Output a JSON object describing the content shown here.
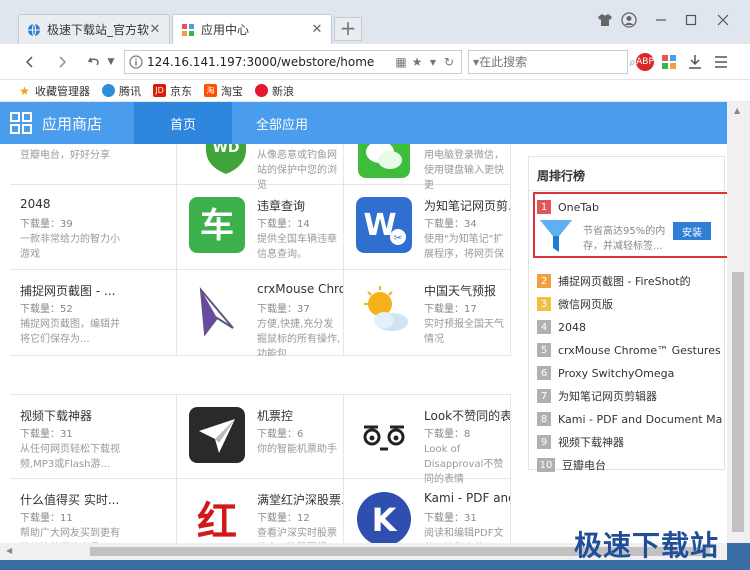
{
  "tabs": [
    {
      "title": "极速下载站_官方软件下载",
      "active": false
    },
    {
      "title": "应用中心",
      "active": true
    }
  ],
  "nav": {
    "url": "124.16.141.197:3000/webstore/home",
    "search_placeholder": "在此搜索"
  },
  "bookmarks": [
    "收藏管理器",
    "腾讯",
    "京东",
    "淘宝",
    "新浪"
  ],
  "store": {
    "brand": "应用商店",
    "nav_home": "首页",
    "nav_all": "全部应用"
  },
  "apps_top": [
    {
      "desc": "豆瓣电台，好好分享"
    },
    {
      "desc": "从像恶意或钓鱼网站的保护中您的浏览"
    },
    {
      "desc": "用电脑登录微信，使用键盘输入更快更"
    }
  ],
  "apps": [
    {
      "name": "2048",
      "downloads": "下载量：39",
      "desc": "一款非常给力的智力小游戏"
    },
    {
      "name": "违章查询",
      "downloads": "下载量：14",
      "desc": "提供全国车辆违章信息查询。"
    },
    {
      "name": "为知笔记网页剪...",
      "downloads": "下载量：34",
      "desc": "使用\"为知笔记\"扩展程序，将网页保"
    },
    {
      "name": "捕捉网页截图 - ...",
      "downloads": "下载量：52",
      "desc": "捕捉网页截图，编辑并将它们保存为..."
    },
    {
      "name": "crxMouse Chro...",
      "downloads": "下载量：37",
      "desc": "方便,快捷,充分发掘鼠标的所有操作,功能包"
    },
    {
      "name": "中国天气预报",
      "downloads": "下载量：17",
      "desc": "实时预报全国天气情况"
    },
    {
      "name": "视频下载神器",
      "downloads": "下载量：31",
      "desc": "从任何网页轻松下载视频,MP3或Flash游..."
    },
    {
      "name": "机票控",
      "downloads": "下载量：6",
      "desc": "你的智能机票助手"
    },
    {
      "name": "Look不赞同的表...",
      "downloads": "下载量：8",
      "desc": "Look of Disapproval不赞同的表情"
    },
    {
      "name": "什么值得买 实时...",
      "downloads": "下载量：11",
      "desc": "帮助广大网友买到更有性价比的网购产品"
    },
    {
      "name": "满堂红沪深股票...",
      "downloads": "下载量：12",
      "desc": "查看沪深实时股票信息以及股票报"
    },
    {
      "name": "Kami - PDF and...",
      "downloads": "下载量：31",
      "desc": "阅读和编辑PDF文件，注释文件"
    }
  ],
  "sidebar": {
    "title": "周排行榜",
    "featured": {
      "rank": "1",
      "name": "OneTab",
      "desc_line1": "节省高达95%的内",
      "desc_line2": "存，并减轻标签...",
      "install": "安装"
    },
    "items": [
      {
        "rank": "2",
        "name": "捕捉网页截图 - FireShot的"
      },
      {
        "rank": "3",
        "name": "微信网页版"
      },
      {
        "rank": "4",
        "name": "2048"
      },
      {
        "rank": "5",
        "name": "crxMouse Chrome™ Gestures"
      },
      {
        "rank": "6",
        "name": "Proxy SwitchyOmega"
      },
      {
        "rank": "7",
        "name": "为知笔记网页剪辑器"
      },
      {
        "rank": "8",
        "name": "Kami - PDF and Document Mar..."
      },
      {
        "rank": "9",
        "name": "视频下载神器"
      },
      {
        "rank": "10",
        "name": "豆瓣电台"
      }
    ]
  },
  "watermark": "极速下载站",
  "colors": {
    "accent": "#4a9cec",
    "accent_dark": "#2e86dd",
    "rank_top": "#e0555a",
    "rank_mid": "#f0a040",
    "rank_low": "#b0b0b0"
  }
}
